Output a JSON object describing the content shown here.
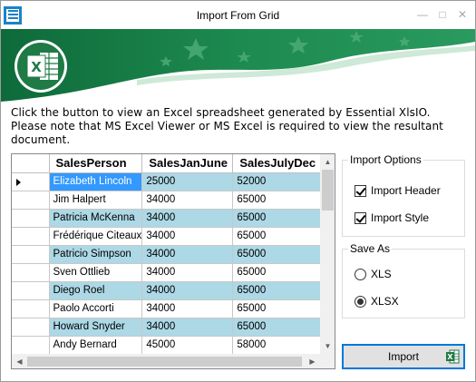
{
  "window": {
    "title": "Import From Grid",
    "minimize_glyph": "—",
    "maximize_glyph": "□",
    "close_glyph": "✕"
  },
  "description": "Click the button to view an Excel spreadsheet generated by Essential XlsIO. Please note that MS Excel Viewer or MS Excel is required to view the resultant document.",
  "grid": {
    "columns": [
      "SalesPerson",
      "SalesJanJune",
      "SalesJulyDec"
    ],
    "rows": [
      [
        "Elizabeth Lincoln",
        "25000",
        "52000"
      ],
      [
        "Jim Halpert",
        "34000",
        "65000"
      ],
      [
        "Patricia McKenna",
        "34000",
        "65000"
      ],
      [
        "Frédérique Citeaux",
        "34000",
        "65000"
      ],
      [
        "Patricio Simpson",
        "34000",
        "65000"
      ],
      [
        "Sven Ottlieb",
        "34000",
        "65000"
      ],
      [
        "Diego Roel",
        "34000",
        "65000"
      ],
      [
        "Paolo Accorti",
        "34000",
        "65000"
      ],
      [
        "Howard Snyder",
        "34000",
        "65000"
      ],
      [
        "Andy Bernard",
        "45000",
        "58000"
      ]
    ],
    "selected_row": 0,
    "scroll_up": "▲",
    "scroll_down": "▼",
    "scroll_left": "◀",
    "scroll_right": "▶"
  },
  "import_options": {
    "legend": "Import Options",
    "import_header": {
      "label": "Import Header",
      "checked": true
    },
    "import_style": {
      "label": "Import Style",
      "checked": true
    }
  },
  "save_as": {
    "legend": "Save As",
    "xls": {
      "label": "XLS",
      "selected": false
    },
    "xlsx": {
      "label": "XLSX",
      "selected": true
    }
  },
  "import_button": {
    "label": "Import"
  },
  "colors": {
    "banner_green": "#1b7a45",
    "row_alt": "#add8e6",
    "row_selected": "#3399ff",
    "button_border": "#0078d7"
  },
  "icons": [
    "app-icon",
    "excel-logo-icon",
    "excel-small-icon"
  ]
}
